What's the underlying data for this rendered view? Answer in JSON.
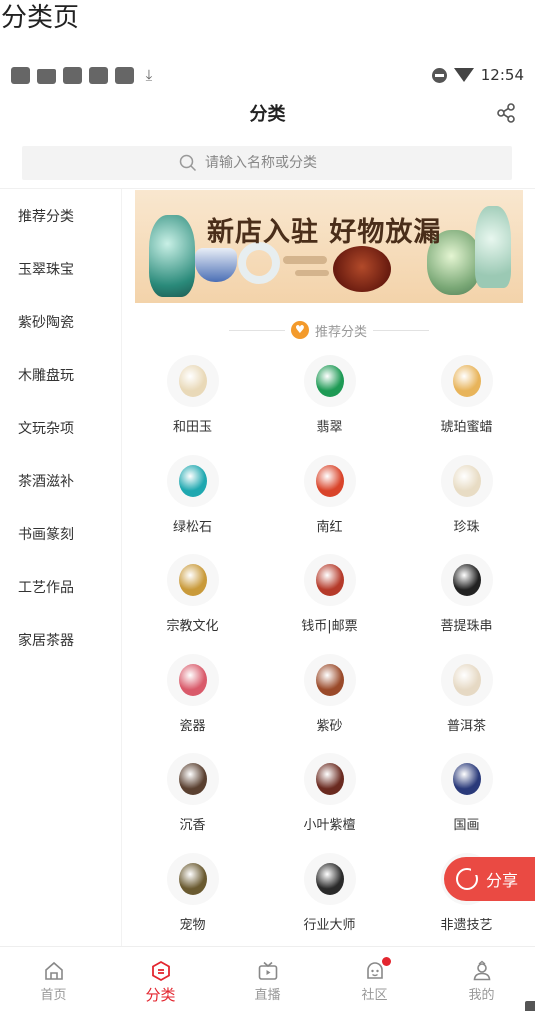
{
  "caption": "分类页",
  "status_bar": {
    "time": "12:54"
  },
  "nav": {
    "title": "分类"
  },
  "search": {
    "placeholder": "请输入名称或分类"
  },
  "sidebar": {
    "items": [
      {
        "label": "推荐分类",
        "active": true
      },
      {
        "label": "玉翠珠宝"
      },
      {
        "label": "紫砂陶瓷"
      },
      {
        "label": "木雕盘玩"
      },
      {
        "label": "文玩杂项"
      },
      {
        "label": "茶酒滋补"
      },
      {
        "label": "书画篆刻"
      },
      {
        "label": "工艺作品"
      },
      {
        "label": "家居茶器"
      }
    ]
  },
  "banner": {
    "text": "新店入驻 好物放漏"
  },
  "section": {
    "title": "推荐分类"
  },
  "categories": [
    {
      "label": "和田玉",
      "icon": "hetian-jade-icon",
      "color": "#e9d9b8"
    },
    {
      "label": "翡翠",
      "icon": "jadeite-icon",
      "color": "#1e9a55"
    },
    {
      "label": "琥珀蜜蜡",
      "icon": "amber-icon",
      "color": "#e8b45a"
    },
    {
      "label": "绿松石",
      "icon": "turquoise-icon",
      "color": "#1fa8b0"
    },
    {
      "label": "南红",
      "icon": "south-red-agate-icon",
      "color": "#d9442a"
    },
    {
      "label": "珍珠",
      "icon": "pearl-icon",
      "color": "#e8dcc4"
    },
    {
      "label": "宗教文化",
      "icon": "buddha-statue-icon",
      "color": "#c99a3a"
    },
    {
      "label": "钱币|邮票",
      "icon": "coin-stamp-icon",
      "color": "#b53a2a"
    },
    {
      "label": "菩提珠串",
      "icon": "bodhi-beads-icon",
      "color": "#222222"
    },
    {
      "label": "瓷器",
      "icon": "porcelain-bowl-icon",
      "color": "#d95a6a"
    },
    {
      "label": "紫砂",
      "icon": "teapot-icon",
      "color": "#9a4a2a"
    },
    {
      "label": "普洱茶",
      "icon": "puer-tea-icon",
      "color": "#e6d9c4"
    },
    {
      "label": "沉香",
      "icon": "agarwood-icon",
      "color": "#5a4030"
    },
    {
      "label": "小叶紫檀",
      "icon": "sandalwood-beads-icon",
      "color": "#6a2a20"
    },
    {
      "label": "国画",
      "icon": "chinese-painting-icon",
      "color": "#2a3a7a"
    },
    {
      "label": "宠物",
      "icon": "turtle-icon",
      "color": "#6a5a30"
    },
    {
      "label": "行业大师",
      "icon": "master-icon",
      "color": "#2a2a2a"
    },
    {
      "label": "非遗技艺",
      "icon": "heritage-craft-icon",
      "color": "#c8a880"
    }
  ],
  "share_button": {
    "label": "分享"
  },
  "tabs": [
    {
      "label": "首页",
      "icon": "home-icon"
    },
    {
      "label": "分类",
      "icon": "category-icon",
      "active": true
    },
    {
      "label": "直播",
      "icon": "live-tv-icon"
    },
    {
      "label": "社区",
      "icon": "community-icon",
      "badge": true
    },
    {
      "label": "我的",
      "icon": "profile-icon"
    }
  ],
  "colors": {
    "accent": "#e3262f",
    "share": "#ea4a43",
    "section_icon": "#f39a2b"
  }
}
